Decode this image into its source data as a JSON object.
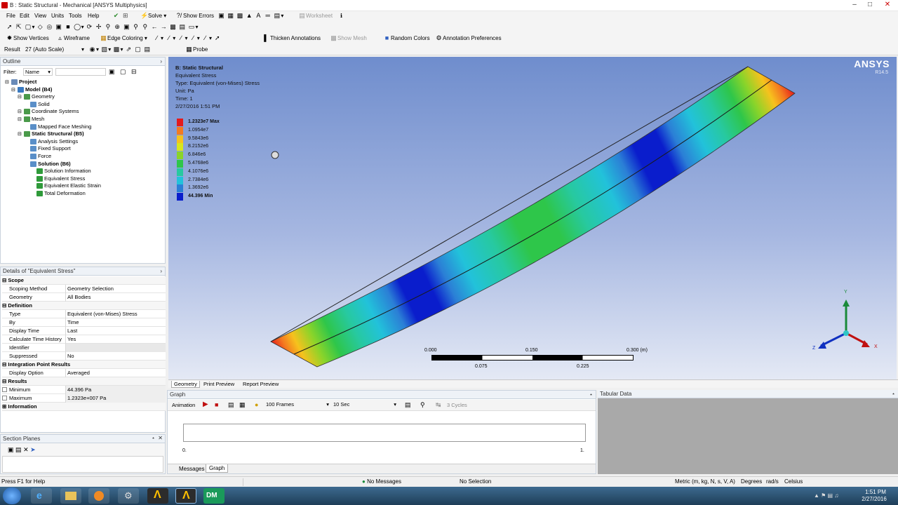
{
  "window": {
    "title": "B : Static Structural - Mechanical [ANSYS Multiphysics]"
  },
  "menu": [
    "File",
    "Edit",
    "View",
    "Units",
    "Tools",
    "Help"
  ],
  "toolbar1": {
    "solve": "Solve",
    "show_errors": "Show Errors",
    "worksheet": "Worksheet"
  },
  "toolbar2": {
    "show_vertices": "Show Vertices",
    "wireframe": "Wireframe",
    "edge_coloring": "Edge Coloring",
    "thicken_annotations": "Thicken Annotations",
    "show_mesh": "Show Mesh",
    "random_colors": "Random Colors",
    "annotation_preferences": "Annotation Preferences"
  },
  "toolbar3": {
    "result_label": "Result",
    "result_value": "27 (Auto Scale)",
    "probe": "Probe"
  },
  "outline": {
    "title": "Outline",
    "filter_label": "Filter:",
    "filter_value": "Name",
    "tree": [
      {
        "label": "Project",
        "level": 0,
        "bold": true,
        "icon": "project-icon"
      },
      {
        "label": "Model (B4)",
        "level": 1,
        "bold": true,
        "icon": "model-icon"
      },
      {
        "label": "Geometry",
        "level": 2,
        "bold": false,
        "icon": "geometry-icon"
      },
      {
        "label": "Solid",
        "level": 3,
        "bold": false,
        "icon": "solid-icon"
      },
      {
        "label": "Coordinate Systems",
        "level": 2,
        "bold": false,
        "icon": "coordinate-systems-icon"
      },
      {
        "label": "Mesh",
        "level": 2,
        "bold": false,
        "icon": "mesh-icon"
      },
      {
        "label": "Mapped Face Meshing",
        "level": 3,
        "bold": false,
        "icon": "mapped-face-meshing-icon"
      },
      {
        "label": "Static Structural (B5)",
        "level": 2,
        "bold": true,
        "icon": "static-structural-icon"
      },
      {
        "label": "Analysis Settings",
        "level": 3,
        "bold": false,
        "icon": "analysis-settings-icon"
      },
      {
        "label": "Fixed Support",
        "level": 3,
        "bold": false,
        "icon": "fixed-support-icon"
      },
      {
        "label": "Force",
        "level": 3,
        "bold": false,
        "icon": "force-icon"
      },
      {
        "label": "Solution (B6)",
        "level": 3,
        "bold": true,
        "icon": "solution-icon"
      },
      {
        "label": "Solution Information",
        "level": 4,
        "bold": false,
        "icon": "solution-information-icon"
      },
      {
        "label": "Equivalent Stress",
        "level": 4,
        "bold": false,
        "icon": "equivalent-stress-icon"
      },
      {
        "label": "Equivalent Elastic Strain",
        "level": 4,
        "bold": false,
        "icon": "equivalent-elastic-strain-icon"
      },
      {
        "label": "Total Deformation",
        "level": 4,
        "bold": false,
        "icon": "total-deformation-icon"
      }
    ]
  },
  "details": {
    "title": "Details of \"Equivalent Stress\"",
    "sections": [
      {
        "name": "Scope",
        "rows": [
          [
            "Scoping Method",
            "Geometry Selection"
          ],
          [
            "Geometry",
            "All Bodies"
          ]
        ]
      },
      {
        "name": "Definition",
        "rows": [
          [
            "Type",
            "Equivalent (von-Mises) Stress"
          ],
          [
            "By",
            "Time"
          ],
          [
            "Display Time",
            "Last"
          ],
          [
            "Calculate Time History",
            "Yes"
          ],
          [
            "Identifier",
            ""
          ],
          [
            "Suppressed",
            "No"
          ]
        ]
      },
      {
        "name": "Integration Point Results",
        "rows": [
          [
            "Display Option",
            "Averaged"
          ]
        ]
      },
      {
        "name": "Results",
        "rows": [
          [
            "Minimum",
            "44.396 Pa"
          ],
          [
            "Maximum",
            "1.2323e+007 Pa"
          ]
        ]
      },
      {
        "name": "Information",
        "rows": []
      }
    ]
  },
  "section_planes": {
    "title": "Section Planes"
  },
  "viewport": {
    "info": {
      "line1": "B: Static Structural",
      "line2": "Equivalent Stress",
      "line3": "Type: Equivalent (von-Mises) Stress",
      "line4": "Unit: Pa",
      "line5": "Time: 1",
      "line6": "2/27/2016 1:51 PM"
    },
    "legend": [
      {
        "label": "1.2323e7 Max",
        "color": "#e41a1c",
        "bold": true
      },
      {
        "label": "1.0954e7",
        "color": "#f47a20",
        "bold": false
      },
      {
        "label": "9.5843e6",
        "color": "#f6c21d",
        "bold": false
      },
      {
        "label": "8.2152e6",
        "color": "#d8e61c",
        "bold": false
      },
      {
        "label": "6.846e6",
        "color": "#8ad42a",
        "bold": false
      },
      {
        "label": "5.4768e6",
        "color": "#2ec64a",
        "bold": false
      },
      {
        "label": "4.1076e6",
        "color": "#27c9a0",
        "bold": false
      },
      {
        "label": "2.7384e6",
        "color": "#22c2da",
        "bold": false
      },
      {
        "label": "1.3692e6",
        "color": "#2b7fd6",
        "bold": false
      },
      {
        "label": "44.396 Min",
        "color": "#0a1dcc",
        "bold": true
      }
    ],
    "brand": "ANSYS",
    "version": "R14.5",
    "scale": {
      "top": [
        "0.000",
        "0.150",
        "0.300 (m)"
      ],
      "bottom": [
        "0.075",
        "0.225"
      ]
    },
    "axes": {
      "x": "X",
      "y": "Y",
      "z": "Z"
    }
  },
  "view_tabs": [
    "Geometry",
    "Print Preview",
    "Report Preview"
  ],
  "graph": {
    "title": "Graph",
    "animation": "Animation",
    "frames": "100 Frames",
    "duration": "10 Sec",
    "cycles": "3 Cycles",
    "x_start": "0.",
    "x_end": "1.",
    "tabs": [
      "Messages",
      "Graph"
    ]
  },
  "tabular": {
    "title": "Tabular Data"
  },
  "status": {
    "help": "Press F1 for Help",
    "messages": "No Messages",
    "selection": "No Selection",
    "units": "Metric (m, kg, N, s, V, A)",
    "angle": "Degrees",
    "rot": "rad/s",
    "temp": "Celsius"
  },
  "taskbar": {
    "time": "1:51 PM",
    "date": "2/27/2016"
  }
}
